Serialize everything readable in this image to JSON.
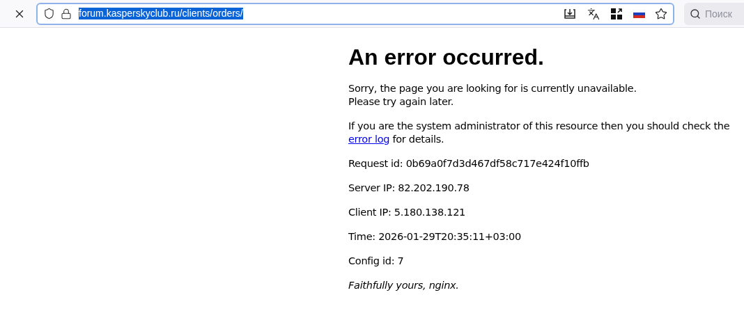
{
  "toolbar": {
    "url": {
      "value": "forum.kasperskyclub.ru/clients/orders/",
      "selected": true
    },
    "search": {
      "placeholder": "Поиск"
    }
  },
  "page": {
    "title": "An error occurred.",
    "paragraphs": [
      {
        "kind": "plain",
        "text": "Sorry, the page you are looking for is currently unavailable.\nPlease try again later."
      },
      {
        "kind": "link",
        "before": "If you are the system administrator of this resource then you should check the ",
        "link": "error log",
        "after": " for details."
      },
      {
        "kind": "plain",
        "text": "Request id: 0b69a0f7d3d467df58c717e424f10ffb"
      },
      {
        "kind": "plain",
        "text": "Server IP: 82.202.190.78"
      },
      {
        "kind": "plain",
        "text": "Client IP: 5.180.138.121"
      },
      {
        "kind": "plain",
        "text": "Time: 2026-01-29T20:35:11+03:00"
      },
      {
        "kind": "plain",
        "text": "Config id: 7"
      },
      {
        "kind": "signature",
        "text": "Faithfully yours, nginx."
      }
    ]
  }
}
